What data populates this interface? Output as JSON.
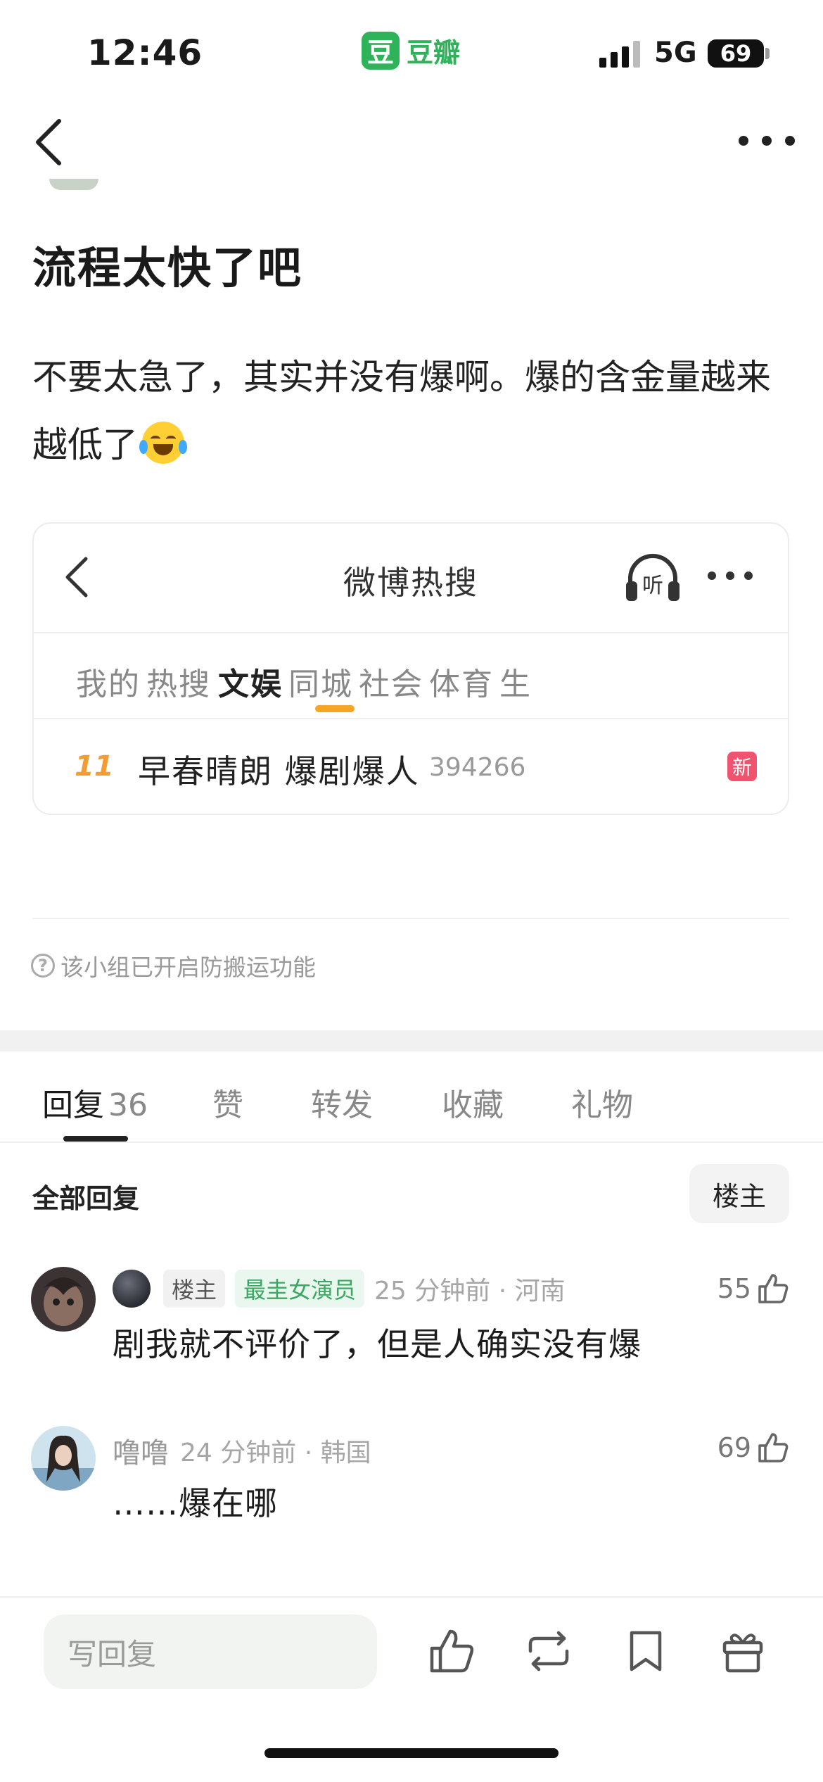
{
  "status_bar": {
    "time": "12:46",
    "app_logo_char": "豆",
    "app_name": "豆瓣",
    "network": "5G",
    "battery": "69"
  },
  "nav": {
    "back_icon": "chevron-left-icon",
    "more_icon": "more-horizontal-icon"
  },
  "post": {
    "title": "流程太快了吧",
    "body": "不要太急了，其实并没有爆啊。爆的含金量越来越低了",
    "emoji": "joy-emoji"
  },
  "weibo_card": {
    "title": "微博热搜",
    "listen_label": "听",
    "tabs": [
      {
        "label": "我的"
      },
      {
        "label": "热搜"
      },
      {
        "label": "文娱",
        "active": true
      },
      {
        "label": "同城"
      },
      {
        "label": "社会"
      },
      {
        "label": "体育"
      },
      {
        "label": "生"
      }
    ],
    "hot_item": {
      "rank": "11",
      "text": "早春晴朗 爆剧爆人",
      "count": "394266",
      "badge": "新"
    },
    "accent_color": "#f5a623"
  },
  "notice": {
    "icon": "?",
    "text": "该小组已开启防搬运功能"
  },
  "reply_tabs": [
    {
      "label": "回复",
      "count": "36",
      "active": true
    },
    {
      "label": "赞"
    },
    {
      "label": "转发"
    },
    {
      "label": "收藏"
    },
    {
      "label": "礼物"
    }
  ],
  "filter": {
    "label": "全部回复",
    "op_button": "楼主"
  },
  "comments": [
    {
      "tag_op": "楼主",
      "tag_fan": "最圭女演员",
      "time": "25 分钟前 · 河南",
      "text": "剧我就不评价了，但是人确实没有爆",
      "likes": "55"
    },
    {
      "user": "噜噜",
      "time": "24 分钟前 · 韩国",
      "text": "……爆在哪",
      "likes": "69"
    }
  ],
  "bottom_bar": {
    "reply_placeholder": "写回复",
    "icons": [
      "thumbs-up-icon",
      "repost-icon",
      "bookmark-icon",
      "gift-icon"
    ]
  },
  "colors": {
    "douban_green": "#2fb35a",
    "rank_orange": "#f39c33",
    "new_badge": "#f0526f",
    "fan_tag_green": "#3aa861"
  }
}
